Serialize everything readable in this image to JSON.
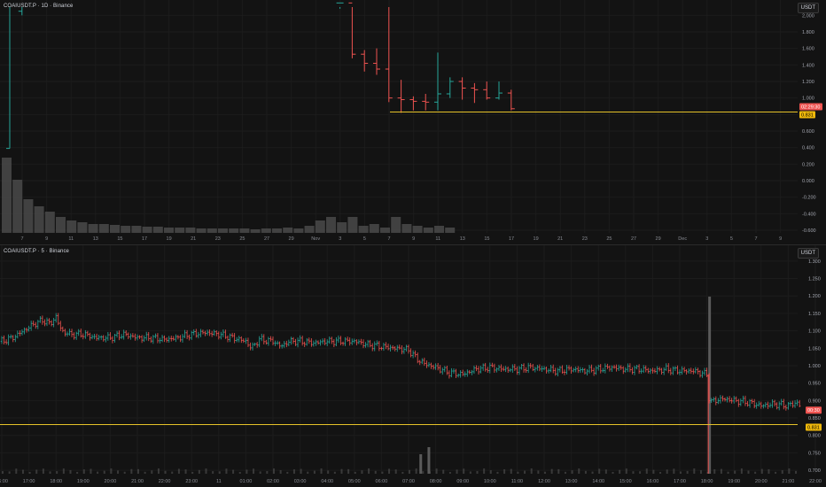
{
  "top_pane": {
    "symbol_label": "COAIUSDT.P · 1D · Binance",
    "unit_button": "USDT",
    "price_tag_red": "02:29:30",
    "price_tag_yellow": "0.831"
  },
  "bottom_pane": {
    "symbol_label": "COAIUSDT.P · 5 · Binance",
    "unit_button": "USDT",
    "price_tag_red": "00:30",
    "price_tag_yellow": "0.831"
  },
  "colors": {
    "background": "#131313",
    "up": "#26a69a",
    "down": "#ef5350",
    "price_line": "#e6c229",
    "grid": "#1c1c1c",
    "volume": "#4a4a4a"
  },
  "chart_data": [
    {
      "type": "candlestick",
      "timeframe": "1D",
      "ylim": [
        -0.6,
        2.2
      ],
      "y_ticks": [
        2.0,
        1.8,
        1.6,
        1.4,
        1.2,
        1.0,
        0.8,
        0.6,
        0.4,
        0.2,
        0.0,
        -0.2,
        -0.4,
        -0.6
      ],
      "x_ticks": [
        "7",
        "9",
        "11",
        "13",
        "15",
        "17",
        "19",
        "21",
        "23",
        "25",
        "27",
        "29",
        "Nov",
        "3",
        "5",
        "7",
        "9",
        "11",
        "13",
        "15",
        "17",
        "19",
        "21",
        "23",
        "25",
        "27",
        "29",
        "Dec",
        "3",
        "5",
        "7",
        "9"
      ],
      "horizontal_line": 0.831,
      "candles": [
        {
          "day": 0,
          "open": 0.39,
          "high": 2.2,
          "low": 0.39,
          "close": 2.2
        },
        {
          "day": 1,
          "open": 2.05,
          "high": 2.2,
          "low": 2.0,
          "close": 2.2
        },
        {
          "day": 27,
          "open": 2.15,
          "high": 2.2,
          "low": 2.08,
          "close": 2.15
        },
        {
          "day": 28,
          "open": 2.15,
          "high": 2.2,
          "low": 1.48,
          "close": 1.53
        },
        {
          "day": 29,
          "open": 1.53,
          "high": 1.58,
          "low": 1.32,
          "close": 1.42
        },
        {
          "day": 30,
          "open": 1.42,
          "high": 1.6,
          "low": 1.28,
          "close": 1.35
        },
        {
          "day": 31,
          "open": 1.35,
          "high": 2.2,
          "low": 0.95,
          "close": 1.0
        },
        {
          "day": 32,
          "open": 1.0,
          "high": 1.22,
          "low": 0.82,
          "close": 0.98
        },
        {
          "day": 33,
          "open": 0.98,
          "high": 1.02,
          "low": 0.85,
          "close": 0.96
        },
        {
          "day": 34,
          "open": 0.96,
          "high": 1.05,
          "low": 0.85,
          "close": 0.95
        },
        {
          "day": 35,
          "open": 0.95,
          "high": 1.55,
          "low": 0.85,
          "close": 1.05
        },
        {
          "day": 36,
          "open": 1.05,
          "high": 1.25,
          "low": 1.0,
          "close": 1.2
        },
        {
          "day": 37,
          "open": 1.2,
          "high": 1.25,
          "low": 0.98,
          "close": 1.12
        },
        {
          "day": 38,
          "open": 1.12,
          "high": 1.18,
          "low": 0.94,
          "close": 1.1
        },
        {
          "day": 39,
          "open": 1.1,
          "high": 1.2,
          "low": 0.98,
          "close": 1.0
        },
        {
          "day": 40,
          "open": 1.0,
          "high": 1.2,
          "low": 0.98,
          "close": 1.06
        },
        {
          "day": 41,
          "open": 1.06,
          "high": 1.1,
          "low": 0.85,
          "close": 0.87
        }
      ],
      "volume_profile": [
        85,
        60,
        38,
        30,
        24,
        18,
        14,
        12,
        10,
        10,
        9,
        8,
        8,
        7,
        7,
        6,
        6,
        6,
        5,
        5,
        5,
        5,
        5,
        4,
        5,
        5,
        6,
        5,
        8,
        14,
        18,
        12,
        18,
        8,
        10,
        6,
        18,
        10,
        8,
        6,
        8,
        6
      ]
    },
    {
      "type": "candlestick",
      "timeframe": "5",
      "ylim": [
        0.68,
        1.33
      ],
      "y_ticks": [
        1.3,
        1.25,
        1.2,
        1.15,
        1.1,
        1.05,
        1.0,
        0.95,
        0.9,
        0.85,
        0.8,
        0.75,
        0.7
      ],
      "x_ticks": [
        "16:00",
        "17:00",
        "18:00",
        "19:00",
        "20:00",
        "21:00",
        "22:00",
        "23:00",
        "11",
        "01:00",
        "02:00",
        "03:00",
        "04:00",
        "05:00",
        "06:00",
        "07:00",
        "08:00",
        "09:00",
        "10:00",
        "11:00",
        "12:00",
        "13:00",
        "14:00",
        "15:00",
        "16:00",
        "17:00",
        "18:00",
        "19:00",
        "20:00",
        "21:00",
        "22:00"
      ],
      "horizontal_line": 0.831,
      "price_path": [
        [
          16.0,
          1.07
        ],
        [
          16.4,
          1.08
        ],
        [
          16.8,
          1.1
        ],
        [
          17.2,
          1.12
        ],
        [
          17.5,
          1.13
        ],
        [
          17.8,
          1.12
        ],
        [
          18.0,
          1.14
        ],
        [
          18.2,
          1.1
        ],
        [
          18.5,
          1.09
        ],
        [
          19.0,
          1.09
        ],
        [
          19.5,
          1.08
        ],
        [
          20.0,
          1.08
        ],
        [
          20.5,
          1.09
        ],
        [
          21.0,
          1.08
        ],
        [
          21.5,
          1.08
        ],
        [
          22.0,
          1.075
        ],
        [
          22.5,
          1.08
        ],
        [
          23.0,
          1.09
        ],
        [
          23.5,
          1.095
        ],
        [
          24.0,
          1.09
        ],
        [
          24.5,
          1.08
        ],
        [
          25.0,
          1.07
        ],
        [
          25.2,
          1.05
        ],
        [
          25.5,
          1.075
        ],
        [
          26.0,
          1.07
        ],
        [
          26.3,
          1.055
        ],
        [
          26.6,
          1.07
        ],
        [
          27.0,
          1.07
        ],
        [
          27.5,
          1.065
        ],
        [
          28.0,
          1.07
        ],
        [
          28.5,
          1.07
        ],
        [
          29.0,
          1.07
        ],
        [
          29.5,
          1.06
        ],
        [
          30.0,
          1.055
        ],
        [
          30.5,
          1.05
        ],
        [
          31.0,
          1.045
        ],
        [
          31.3,
          1.02
        ],
        [
          31.6,
          1.005
        ],
        [
          32.0,
          0.995
        ],
        [
          32.5,
          0.98
        ],
        [
          33.0,
          0.975
        ],
        [
          33.5,
          0.99
        ],
        [
          34.0,
          0.995
        ],
        [
          34.5,
          0.99
        ],
        [
          35.0,
          0.99
        ],
        [
          35.5,
          0.995
        ],
        [
          36.0,
          0.99
        ],
        [
          36.5,
          0.985
        ],
        [
          37.0,
          0.99
        ],
        [
          37.5,
          0.985
        ],
        [
          38.0,
          0.99
        ],
        [
          38.5,
          0.995
        ],
        [
          39.0,
          0.99
        ],
        [
          39.5,
          0.99
        ],
        [
          40.0,
          0.985
        ],
        [
          40.5,
          0.99
        ],
        [
          41.0,
          0.985
        ],
        [
          41.5,
          0.985
        ],
        [
          42.0,
          0.975
        ],
        [
          42.1,
          0.895
        ],
        [
          42.3,
          0.9
        ],
        [
          42.6,
          0.905
        ],
        [
          43.0,
          0.9
        ],
        [
          43.5,
          0.895
        ],
        [
          44.0,
          0.885
        ],
        [
          44.5,
          0.89
        ],
        [
          45.0,
          0.885
        ],
        [
          45.3,
          0.895
        ],
        [
          45.5,
          0.88
        ]
      ],
      "volume_spikes": [
        [
          31.4,
          22
        ],
        [
          31.7,
          30
        ],
        [
          42.05,
          200
        ]
      ]
    }
  ]
}
